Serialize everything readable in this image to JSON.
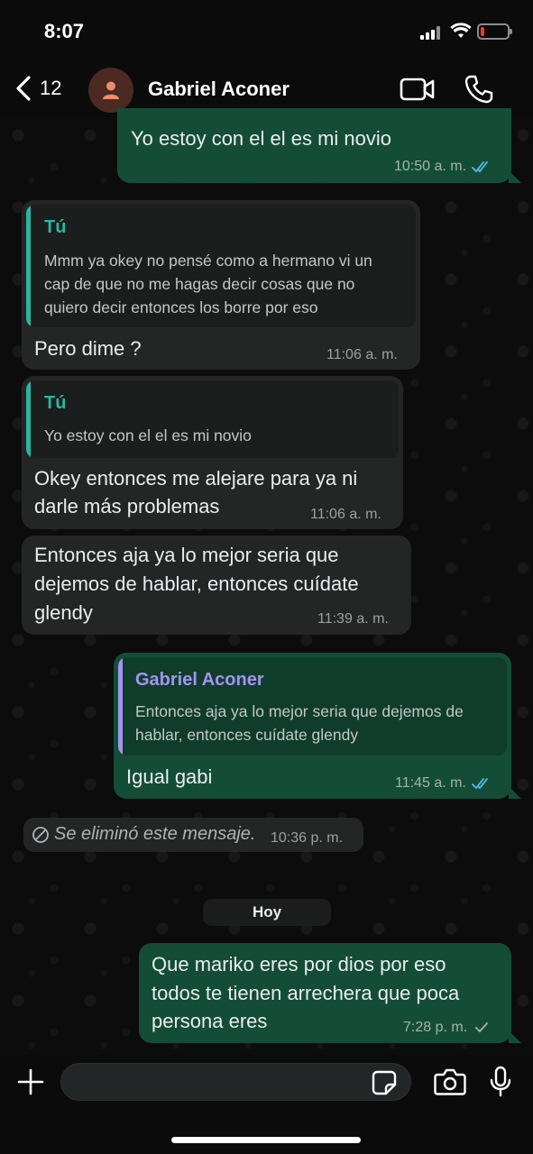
{
  "status_bar": {
    "time": "8:07"
  },
  "header": {
    "back_count": "12",
    "contact_name": "Gabriel Aconer"
  },
  "messages": [
    {
      "direction": "out",
      "text": "Yo estoy con el el es mi novio",
      "time": "10:50",
      "period": "a. m.",
      "status": "read"
    },
    {
      "direction": "in",
      "quote_author": "Tú",
      "quote_lines": [
        "Mmm ya okey no pensé como a hermano vi un",
        "cap de que no me hagas decir cosas que no",
        "quiero decir entonces los borre por eso"
      ],
      "text": "Pero dime ?",
      "time": "11:06",
      "period": "a. m."
    },
    {
      "direction": "in",
      "quote_author": "Tú",
      "quote_lines": [
        "Yo estoy con el el es mi novio"
      ],
      "text_lines": [
        "Okey entonces me alejare para ya ni",
        "darle más problemas"
      ],
      "time": "11:06",
      "period": "a. m."
    },
    {
      "direction": "in",
      "text_lines": [
        "Entonces aja ya lo mejor seria que",
        "dejemos de hablar, entonces cuídate",
        "glendy"
      ],
      "time": "11:39",
      "period": "a. m."
    },
    {
      "direction": "out",
      "quote_author": "Gabriel Aconer",
      "quote_lines": [
        "Entonces aja ya lo mejor seria que dejemos de",
        "hablar, entonces cuídate glendy"
      ],
      "text": "Igual gabi",
      "time": "11:45",
      "period": "a. m.",
      "status": "read"
    },
    {
      "direction": "in",
      "deleted": true,
      "text": "Se eliminó este mensaje.",
      "time": "10:36",
      "period": "p. m."
    },
    {
      "direction": "out",
      "text_lines": [
        "Que mariko eres por dios por eso",
        "todos te tienen arrechera que poca",
        "persona eres"
      ],
      "time": "7:28",
      "period": "p. m.",
      "status": "sent"
    }
  ],
  "date_separator": "Hoy",
  "colors": {
    "outgoing_bubble": "#144d37",
    "incoming_bubble": "#242626",
    "quote_self_accent": "#2bb5a0",
    "quote_contact_accent": "#a394f0",
    "read_ticks": "#53bdeb"
  },
  "icons": [
    "back-chevron-icon",
    "person-icon",
    "video-call-icon",
    "phone-icon",
    "plus-icon",
    "sticker-icon",
    "camera-icon",
    "mic-icon"
  ]
}
